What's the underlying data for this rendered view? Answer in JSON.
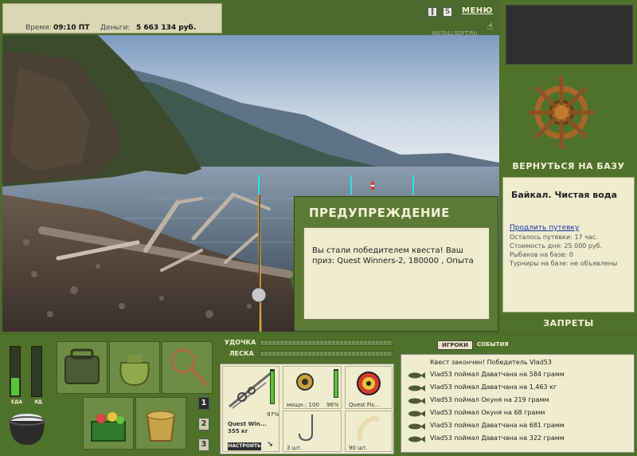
{
  "stats": {
    "time_label": "Время:",
    "time_value": "09:10 ПТ",
    "money_label": "Деньги:",
    "money_value": "5 663 134 руб."
  },
  "topbar": {
    "pause_icon": "pause-icon",
    "sound_label": "S",
    "menu_label": "МЕНЮ",
    "watermark": "INSTALLSOFT.RU"
  },
  "right_panel": {
    "return_label": "ВЕРНУТЬСЯ НА БАЗУ",
    "base_title": "Байкал. Чистая вода",
    "extend_link": "Продлить путевку",
    "lines": [
      "Осталось путевки: 17 час.",
      "Стоимость дня: 25 000 руб.",
      "Рыбаков на базе: 0",
      "Турниры на базе: не объявлены"
    ],
    "bans_label": "ЗАПРЕТЫ"
  },
  "warning": {
    "title": "ПРЕДУПРЕЖДЕНИЕ",
    "message": "Вы стали победителем квеста! Ваш приз: Quest Winners-2, 180000 , Опыта"
  },
  "gauges": {
    "food_label": "ЕДА",
    "food_level": 0.35,
    "poison_label": "ЯД",
    "poison_level": 0
  },
  "pages": [
    "1",
    "2",
    "3"
  ],
  "rod_bars": {
    "rod_label": "УДОЧКА",
    "line_label": "ЛЕСКА"
  },
  "tackle": {
    "rod_name": "Quest Win...",
    "rod_weight": "355 кг",
    "rod_percent": "97%",
    "configure_label": "НАСТРОИТЬ",
    "reel_power": "мощн.: 100",
    "reel_percent": "96%",
    "line_name": "Quest Fis...",
    "hook_count": "3 шт.",
    "bait_count": "90 шт."
  },
  "log": {
    "tab_players": "ИГРОКИ",
    "tab_events": "СОБЫТИЯ",
    "header": "Квест закончен! Победитель Vlad53",
    "entries": [
      "Vlad53 поймал Даватчана на 584 грамм",
      "Vlad53 поймал Даватчана на 1,463 кг",
      "Vlad53 поймал Окуня на 219 грамм",
      "Vlad53 поймал Окуня на 68 грамм",
      "Vlad53 поймал Даватчана на 681 грамм",
      "Vlad53 поймал Даватчана на 322 грамм"
    ]
  },
  "colors": {
    "panel_green": "#4f722b",
    "parchment": "#efeccf",
    "title_cream": "#f4f1d6",
    "gauge_fill": "#59c23a"
  }
}
